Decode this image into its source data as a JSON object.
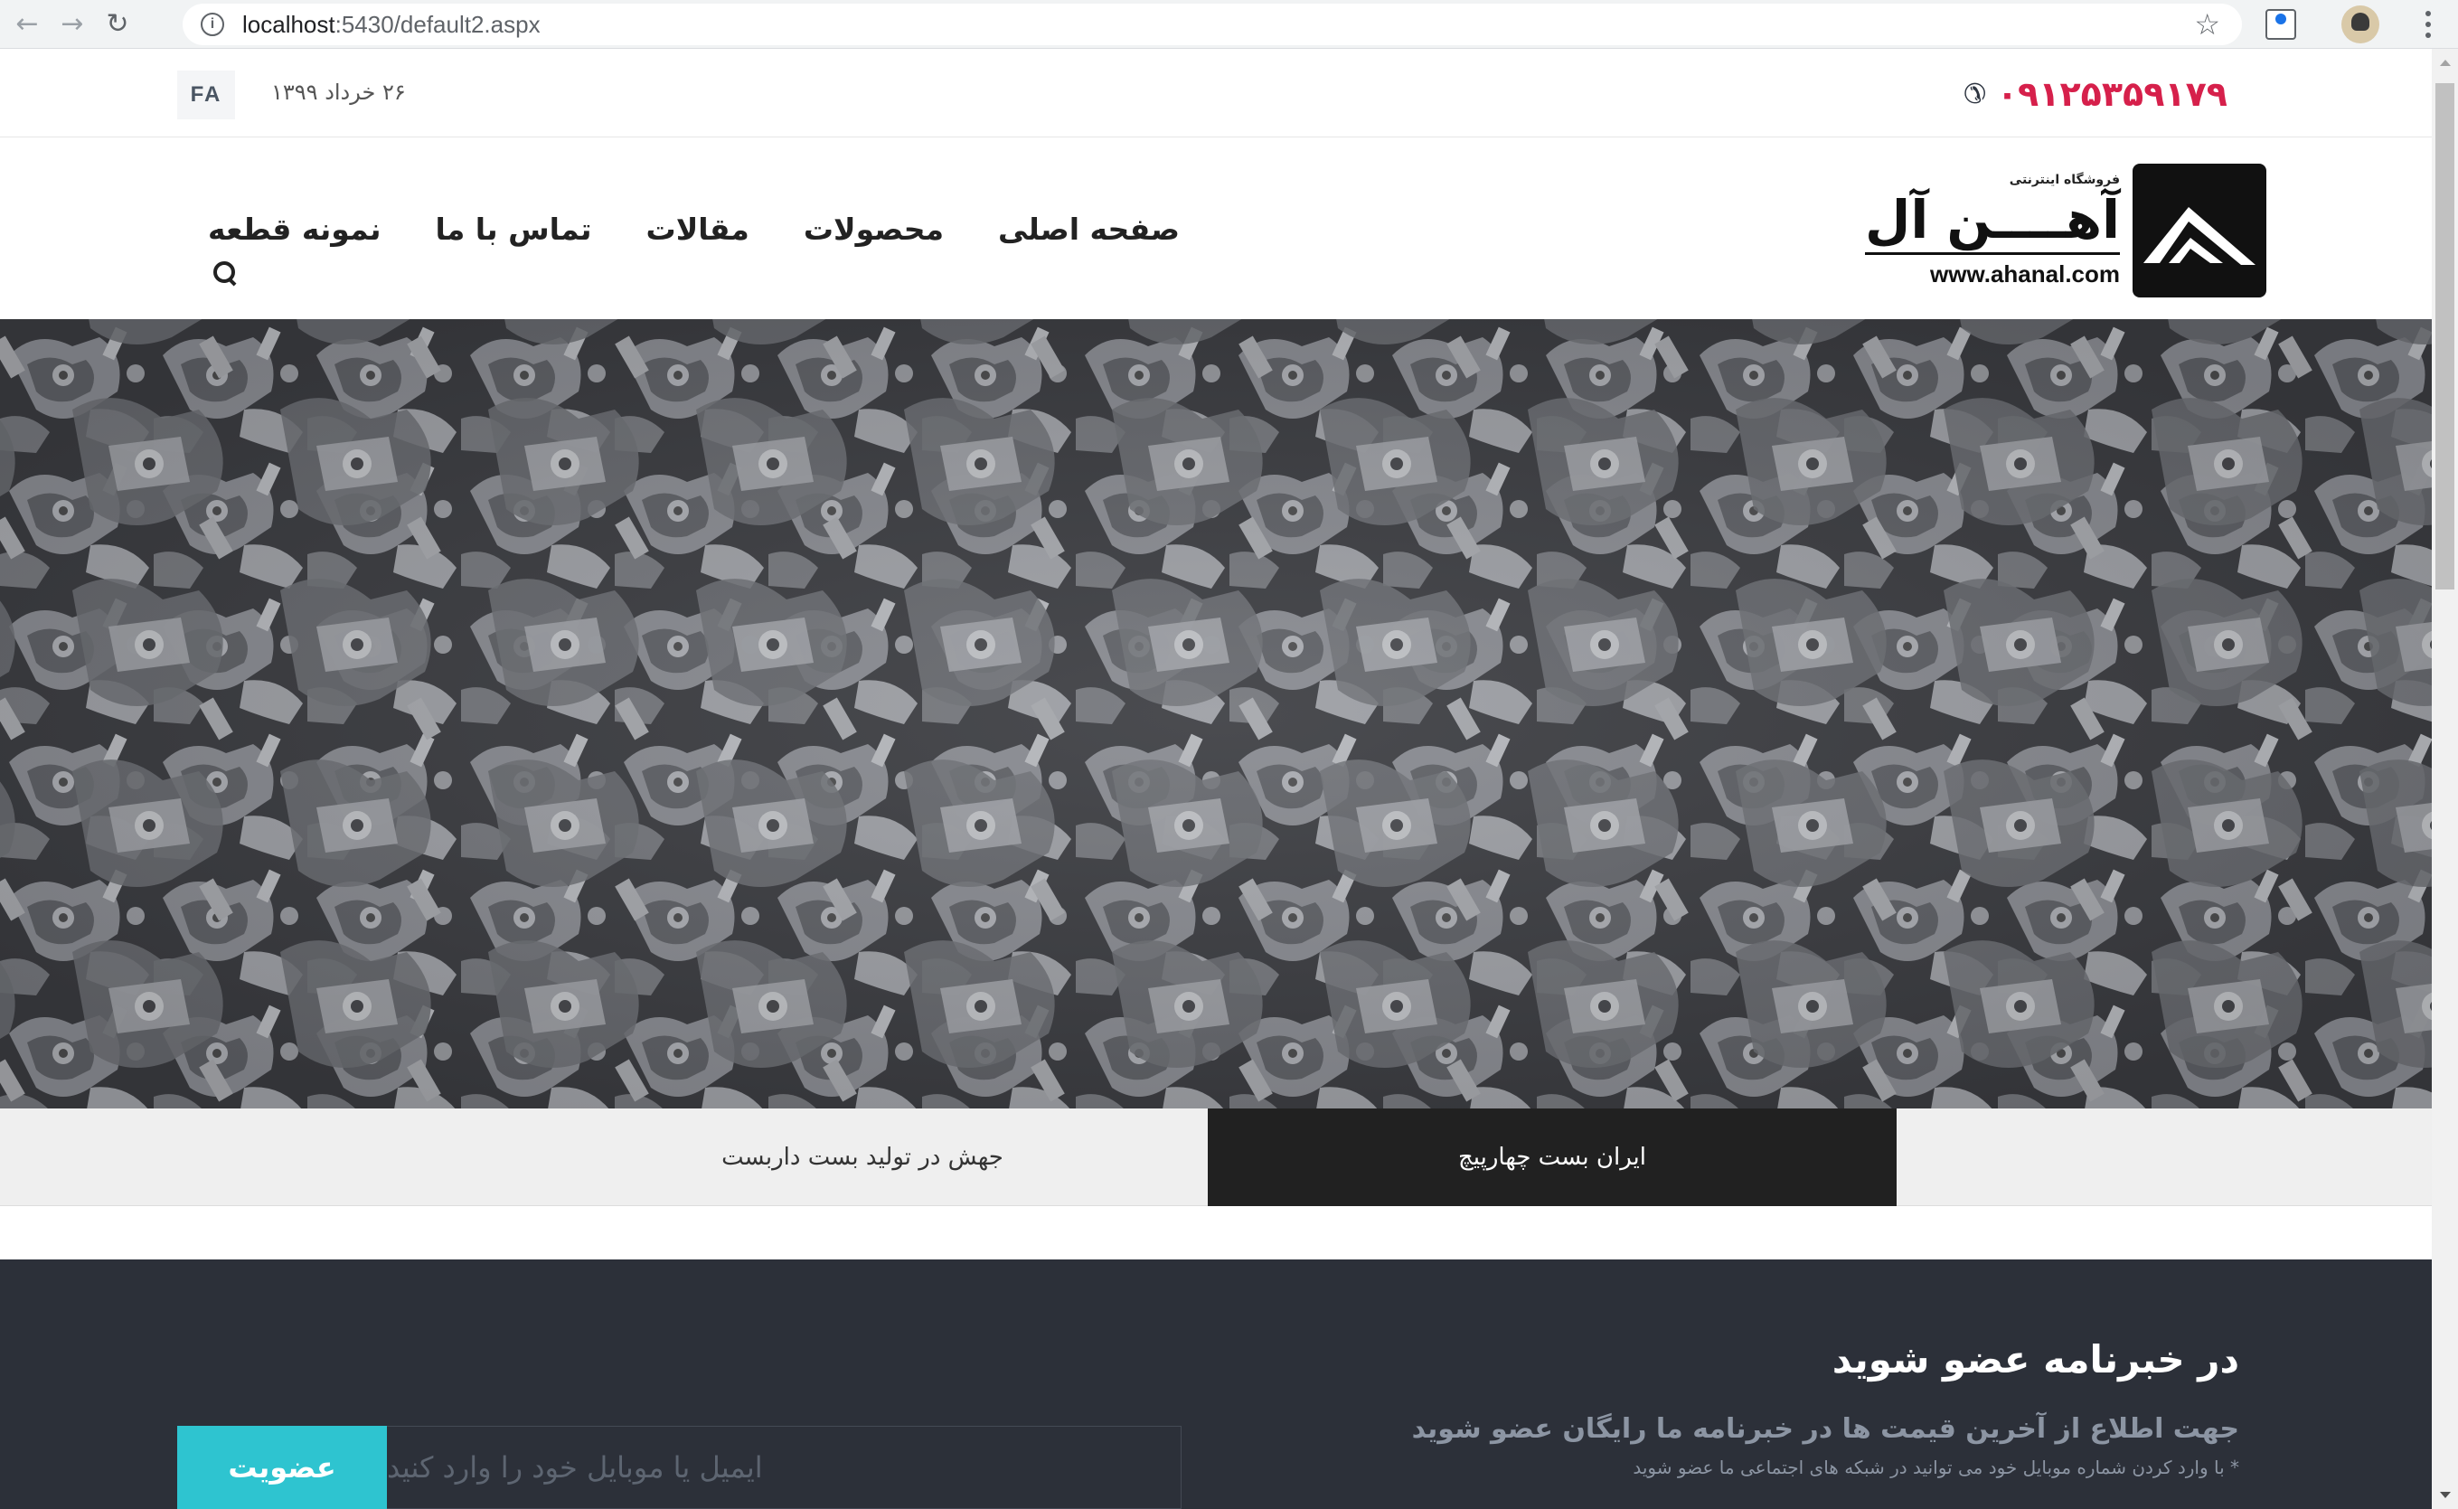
{
  "browser": {
    "url_host": "localhost",
    "url_path": ":5430/default2.aspx",
    "back_icon": "back-arrow-icon",
    "forward_icon": "forward-arrow-icon",
    "reload_icon": "reload-icon"
  },
  "topbar": {
    "lang": "FA",
    "date": "۲۶ خرداد ۱۳۹۹",
    "phone": "۰۹۱۲۵۳۵۹۱۷۹",
    "phone_color": "#d6204b"
  },
  "logo": {
    "small_text": "فروشگاه اینترنتی",
    "name": "آهــــن آل",
    "url": "www.ahanal.com"
  },
  "menu": {
    "items": [
      "صفحه اصلی",
      "محصولات",
      "مقالات",
      "تماس با ما",
      "نمونه قطعه"
    ]
  },
  "tabs": {
    "items": [
      "ایران بست چهارپیچ",
      "جهش در تولید بست داربست"
    ]
  },
  "newsletter": {
    "title": "در خبرنامه عضو شوید",
    "description": "جهت اطلاع از آخرین قیمت ها در خبرنامه ما رایگان عضو شوید",
    "note": "* با وارد کردن شماره موبایل خود می توانید در شبکه های اجتماعی ما عضو شوید",
    "input_placeholder": "ایمیل یا موبایل خود را وارد کنید",
    "button_label": "عضویت",
    "button_color": "#2ec4d0",
    "background_color": "#2c3039"
  }
}
